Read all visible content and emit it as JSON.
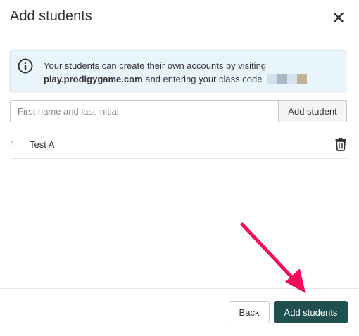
{
  "dialog": {
    "title": "Add students",
    "close_icon": "close-icon"
  },
  "info": {
    "icon": "info-circle-icon",
    "line1": "Your students can create their own accounts by visiting",
    "url": "play.prodigygame.com",
    "line2_rest": " and entering your class code ",
    "code_colors": [
      "#cfe0ec",
      "#a7b8c6",
      "#d6e3ec",
      "#c2b29a"
    ]
  },
  "add_form": {
    "input_placeholder": "First name and last initial",
    "input_value": "",
    "add_button_label": "Add student"
  },
  "students": [
    {
      "number": "1.",
      "name": "Test A",
      "delete_icon": "trash-icon"
    }
  ],
  "footer": {
    "back_label": "Back",
    "add_students_label": "Add students",
    "primary_color": "#1f4f4e"
  },
  "annotation": {
    "arrow_color": "#f0105a"
  }
}
